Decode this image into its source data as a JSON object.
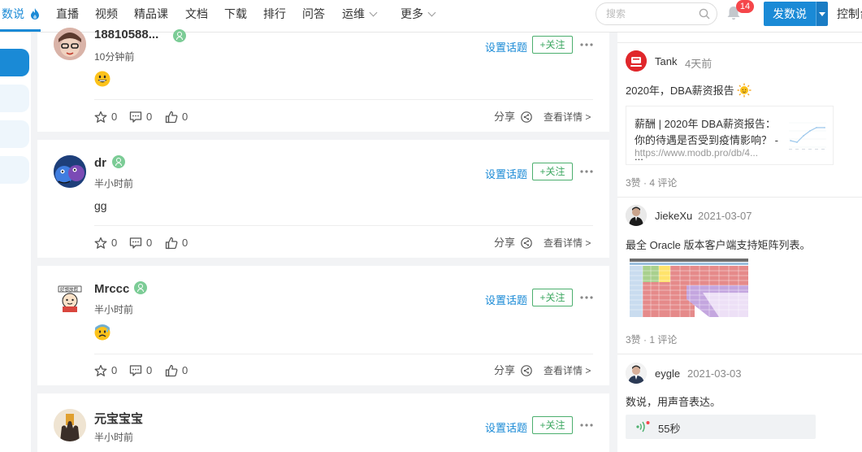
{
  "nav": {
    "items": [
      {
        "label": "数说",
        "active": true
      },
      {
        "label": "直播"
      },
      {
        "label": "视频"
      },
      {
        "label": "精品课"
      },
      {
        "label": "文档"
      },
      {
        "label": "下载"
      },
      {
        "label": "排行"
      },
      {
        "label": "问答"
      },
      {
        "label": "运维",
        "dropdown": true
      },
      {
        "label": "更多",
        "dropdown": true
      }
    ],
    "search_placeholder": "搜索",
    "notification_count": "14",
    "publish_label": "发数说",
    "console_label": "控制台"
  },
  "feed": [
    {
      "user": "18810588...",
      "time": "10分钟前",
      "content_emoji": "grinning-face",
      "set_topic": "设置话题",
      "follow": "+关注",
      "stars": "0",
      "comments": "0",
      "likes": "0",
      "share": "分享",
      "detail": "查看详情 >"
    },
    {
      "user": "dr",
      "time": "半小时前",
      "content": "gg",
      "set_topic": "设置话题",
      "follow": "+关注",
      "stars": "0",
      "comments": "0",
      "likes": "0",
      "share": "分享",
      "detail": "查看详情 >"
    },
    {
      "user": "Mrccc",
      "time": "半小时前",
      "content_emoji": "anxious-face-with-sweat",
      "set_topic": "设置话题",
      "follow": "+关注",
      "stars": "0",
      "comments": "0",
      "likes": "0",
      "share": "分享",
      "detail": "查看详情 >"
    },
    {
      "user": "元宝宝宝",
      "time": "半小时前",
      "set_topic": "设置话题",
      "follow": "+关注"
    }
  ],
  "right_feed": [
    {
      "user": "Tank",
      "time": "4天前",
      "text": "2020年，DBA薪资报告",
      "link_title": "薪酬 | 2020年 DBA薪资报告：你的待遇是否受到疫情影响？ - ...",
      "link_url": "https://www.modb.pro/db/4...",
      "stats": "3赞 · 4 评论"
    },
    {
      "user": "JiekeXu",
      "time": "2021-03-07",
      "text": "最全 Oracle 版本客户端支持矩阵列表。",
      "stats": "3赞 · 1 评论"
    },
    {
      "user": "eygle",
      "time": "2021-03-03",
      "text": "数说，用声音表达。",
      "voice_duration": "55秒"
    }
  ],
  "colors": {
    "accent": "#1a8ad6",
    "follow_green": "#3ea862",
    "badge_red": "#f5464a"
  }
}
